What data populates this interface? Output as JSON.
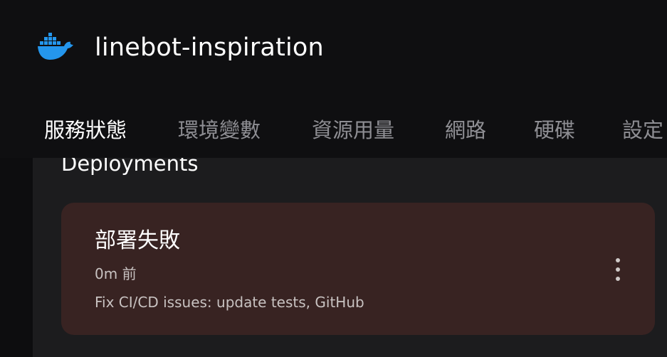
{
  "header": {
    "app_title": "linebot-inspiration",
    "logo_icon": "docker-whale-icon",
    "brand_color": "#2496ed"
  },
  "tabs": [
    {
      "label": "服務狀態",
      "active": true
    },
    {
      "label": "環境變數",
      "active": false
    },
    {
      "label": "資源用量",
      "active": false
    },
    {
      "label": "網路",
      "active": false
    },
    {
      "label": "硬碟",
      "active": false
    },
    {
      "label": "設定",
      "active": false
    }
  ],
  "main": {
    "section_heading": "Deployments",
    "deployment": {
      "status": "部署失敗",
      "time": "0m 前",
      "commit_message": "Fix CI/CD issues: update tests, GitHub",
      "card_color": "#382322",
      "menu_icon": "more-vertical-icon"
    }
  }
}
